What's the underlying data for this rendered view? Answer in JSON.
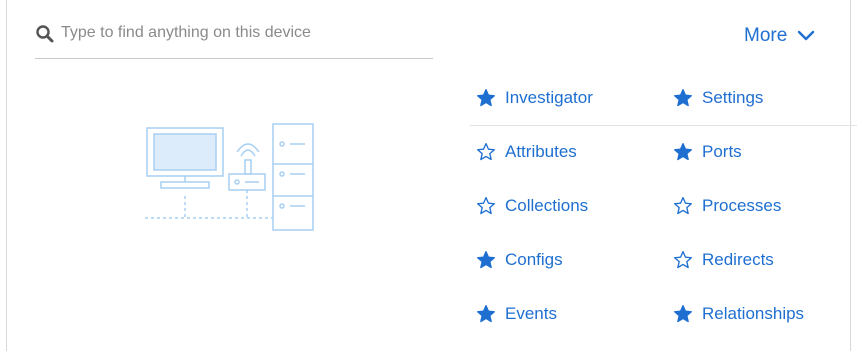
{
  "search": {
    "placeholder": "Type to find anything on this device",
    "value": ""
  },
  "more": {
    "label": "More"
  },
  "colors": {
    "accent": "#1f6fd1",
    "illustration": "#a9cff3"
  },
  "links": [
    {
      "label": "Investigator",
      "starred": true
    },
    {
      "label": "Settings",
      "starred": true
    },
    {
      "label": "Attributes",
      "starred": false
    },
    {
      "label": "Ports",
      "starred": true
    },
    {
      "label": "Collections",
      "starred": false
    },
    {
      "label": "Processes",
      "starred": false
    },
    {
      "label": "Configs",
      "starred": true
    },
    {
      "label": "Redirects",
      "starred": false
    },
    {
      "label": "Events",
      "starred": true
    },
    {
      "label": "Relationships",
      "starred": true
    }
  ]
}
